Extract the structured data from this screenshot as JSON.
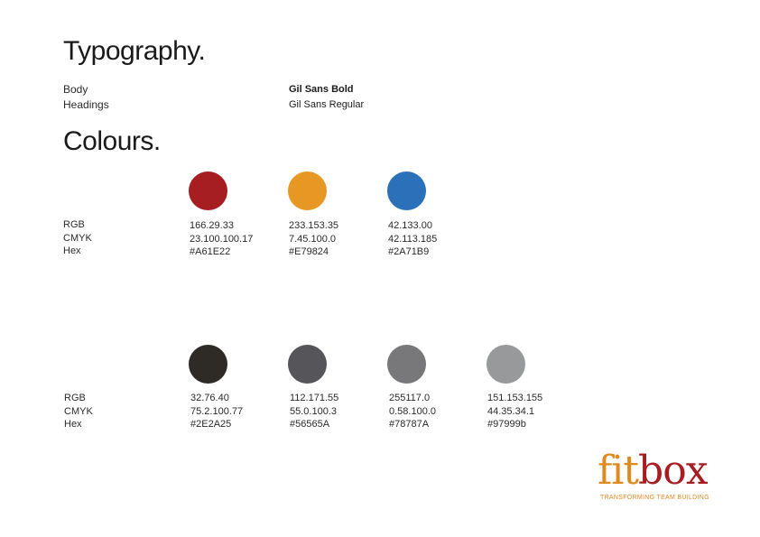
{
  "typography": {
    "title": "Typography.",
    "rows": [
      {
        "label": "Body",
        "font": "Gil Sans Bold"
      },
      {
        "label": "Headings",
        "font": "Gil Sans Regular"
      }
    ]
  },
  "colours": {
    "title": "Colours.",
    "row_labels": [
      "RGB",
      "CMYK",
      "Hex"
    ],
    "primary": [
      {
        "rgb": "166.29.33",
        "cmyk": "23.100.100.17",
        "hex": "#A61E22",
        "swatch": "#A61E22"
      },
      {
        "rgb": "233.153.35",
        "cmyk": "7.45.100.0",
        "hex": "#E79824",
        "swatch": "#E79824"
      },
      {
        "rgb": "42.133.00",
        "cmyk": "42.113.185",
        "hex": "#2A71B9",
        "swatch": "#2A71B9"
      }
    ],
    "secondary": [
      {
        "rgb": "32.76.40",
        "cmyk": "75.2.100.77",
        "hex": "#2E2A25",
        "swatch": "#2E2A25"
      },
      {
        "rgb": "112.171.55",
        "cmyk": "55.0.100.3",
        "hex": "#56565A",
        "swatch": "#56565A"
      },
      {
        "rgb": "255117.0",
        "cmyk": "0.58.100.0",
        "hex": "#78787A",
        "swatch": "#78787A"
      },
      {
        "rgb": "151.153.155",
        "cmyk": "44.35.34.1",
        "hex": "#97999b",
        "swatch": "#97999B"
      }
    ]
  },
  "logo": {
    "part1": "fit",
    "part2": "box",
    "tagline": "TRANSFORMING TEAM BUILDING",
    "color_fit": "#E08A1E",
    "color_box": "#A61E22"
  }
}
